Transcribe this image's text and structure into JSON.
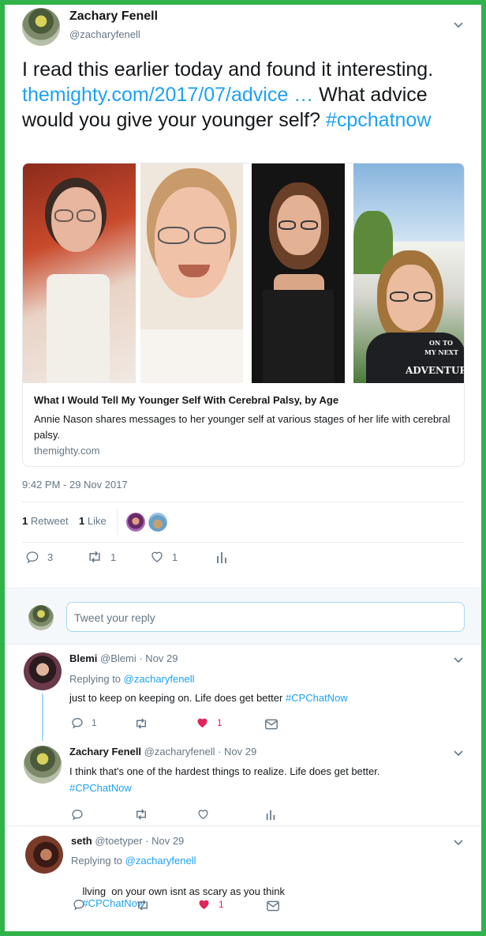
{
  "main_tweet": {
    "name": "Zachary Fenell",
    "handle": "@zacharyfenell",
    "text_before": "I read this earlier today and found it interesting.",
    "link": "themighty.com/2017/07/advice …",
    "text_after": "What advice would you give your younger self?",
    "hashtag": "#cpchatnow",
    "timestamp": "9:42 PM - 29 Nov 2017",
    "retweets_count": "1",
    "retweets_label": "Retweet",
    "likes_count": "1",
    "likes_label": "Like",
    "actions": {
      "replies": "3",
      "retweets": "1",
      "likes": "1"
    }
  },
  "card": {
    "title": "What I Would Tell My Younger Self With Cerebral Palsy, by Age",
    "description": "Annie Nason shares messages to her younger self at various stages of her life with cerebral palsy.",
    "domain": "themighty.com",
    "shirt_text_1": "ON TO",
    "shirt_text_2": "MY NEXT",
    "shirt_text_3": "ADVENTURE"
  },
  "reply_box": {
    "placeholder": "Tweet your reply"
  },
  "replies": [
    {
      "name": "Blemi",
      "handle": "@Blemi",
      "date": "· Nov 29",
      "replying_label": "Replying to",
      "replying_to": "@zacharyfenell",
      "text": "just to keep on keeping on. Life does get better",
      "hashtag": "#CPChatNow",
      "counts": {
        "replies": "1",
        "retweets": "",
        "likes": "1"
      }
    },
    {
      "name": "Zachary Fenell",
      "handle": "@zacharyfenell",
      "date": "· Nov 29",
      "text": "I think that's one of the hardest things to realize. Life does get better.",
      "hashtag": "#CPChatNow",
      "counts": {
        "replies": "",
        "retweets": "",
        "likes": ""
      }
    },
    {
      "name": "seth",
      "handle": "@toetyper",
      "date": "· Nov 29",
      "replying_label": "Replying to",
      "replying_to": "@zacharyfenell",
      "text": "llving  on your own isnt as scary as you think",
      "hashtag": "#CPChatNow",
      "counts": {
        "replies": "",
        "retweets": "",
        "likes": "1"
      }
    }
  ],
  "colors": {
    "frame": "#2fb34a",
    "link": "#1da1f2",
    "like_active": "#e0245e",
    "muted": "#657786"
  }
}
